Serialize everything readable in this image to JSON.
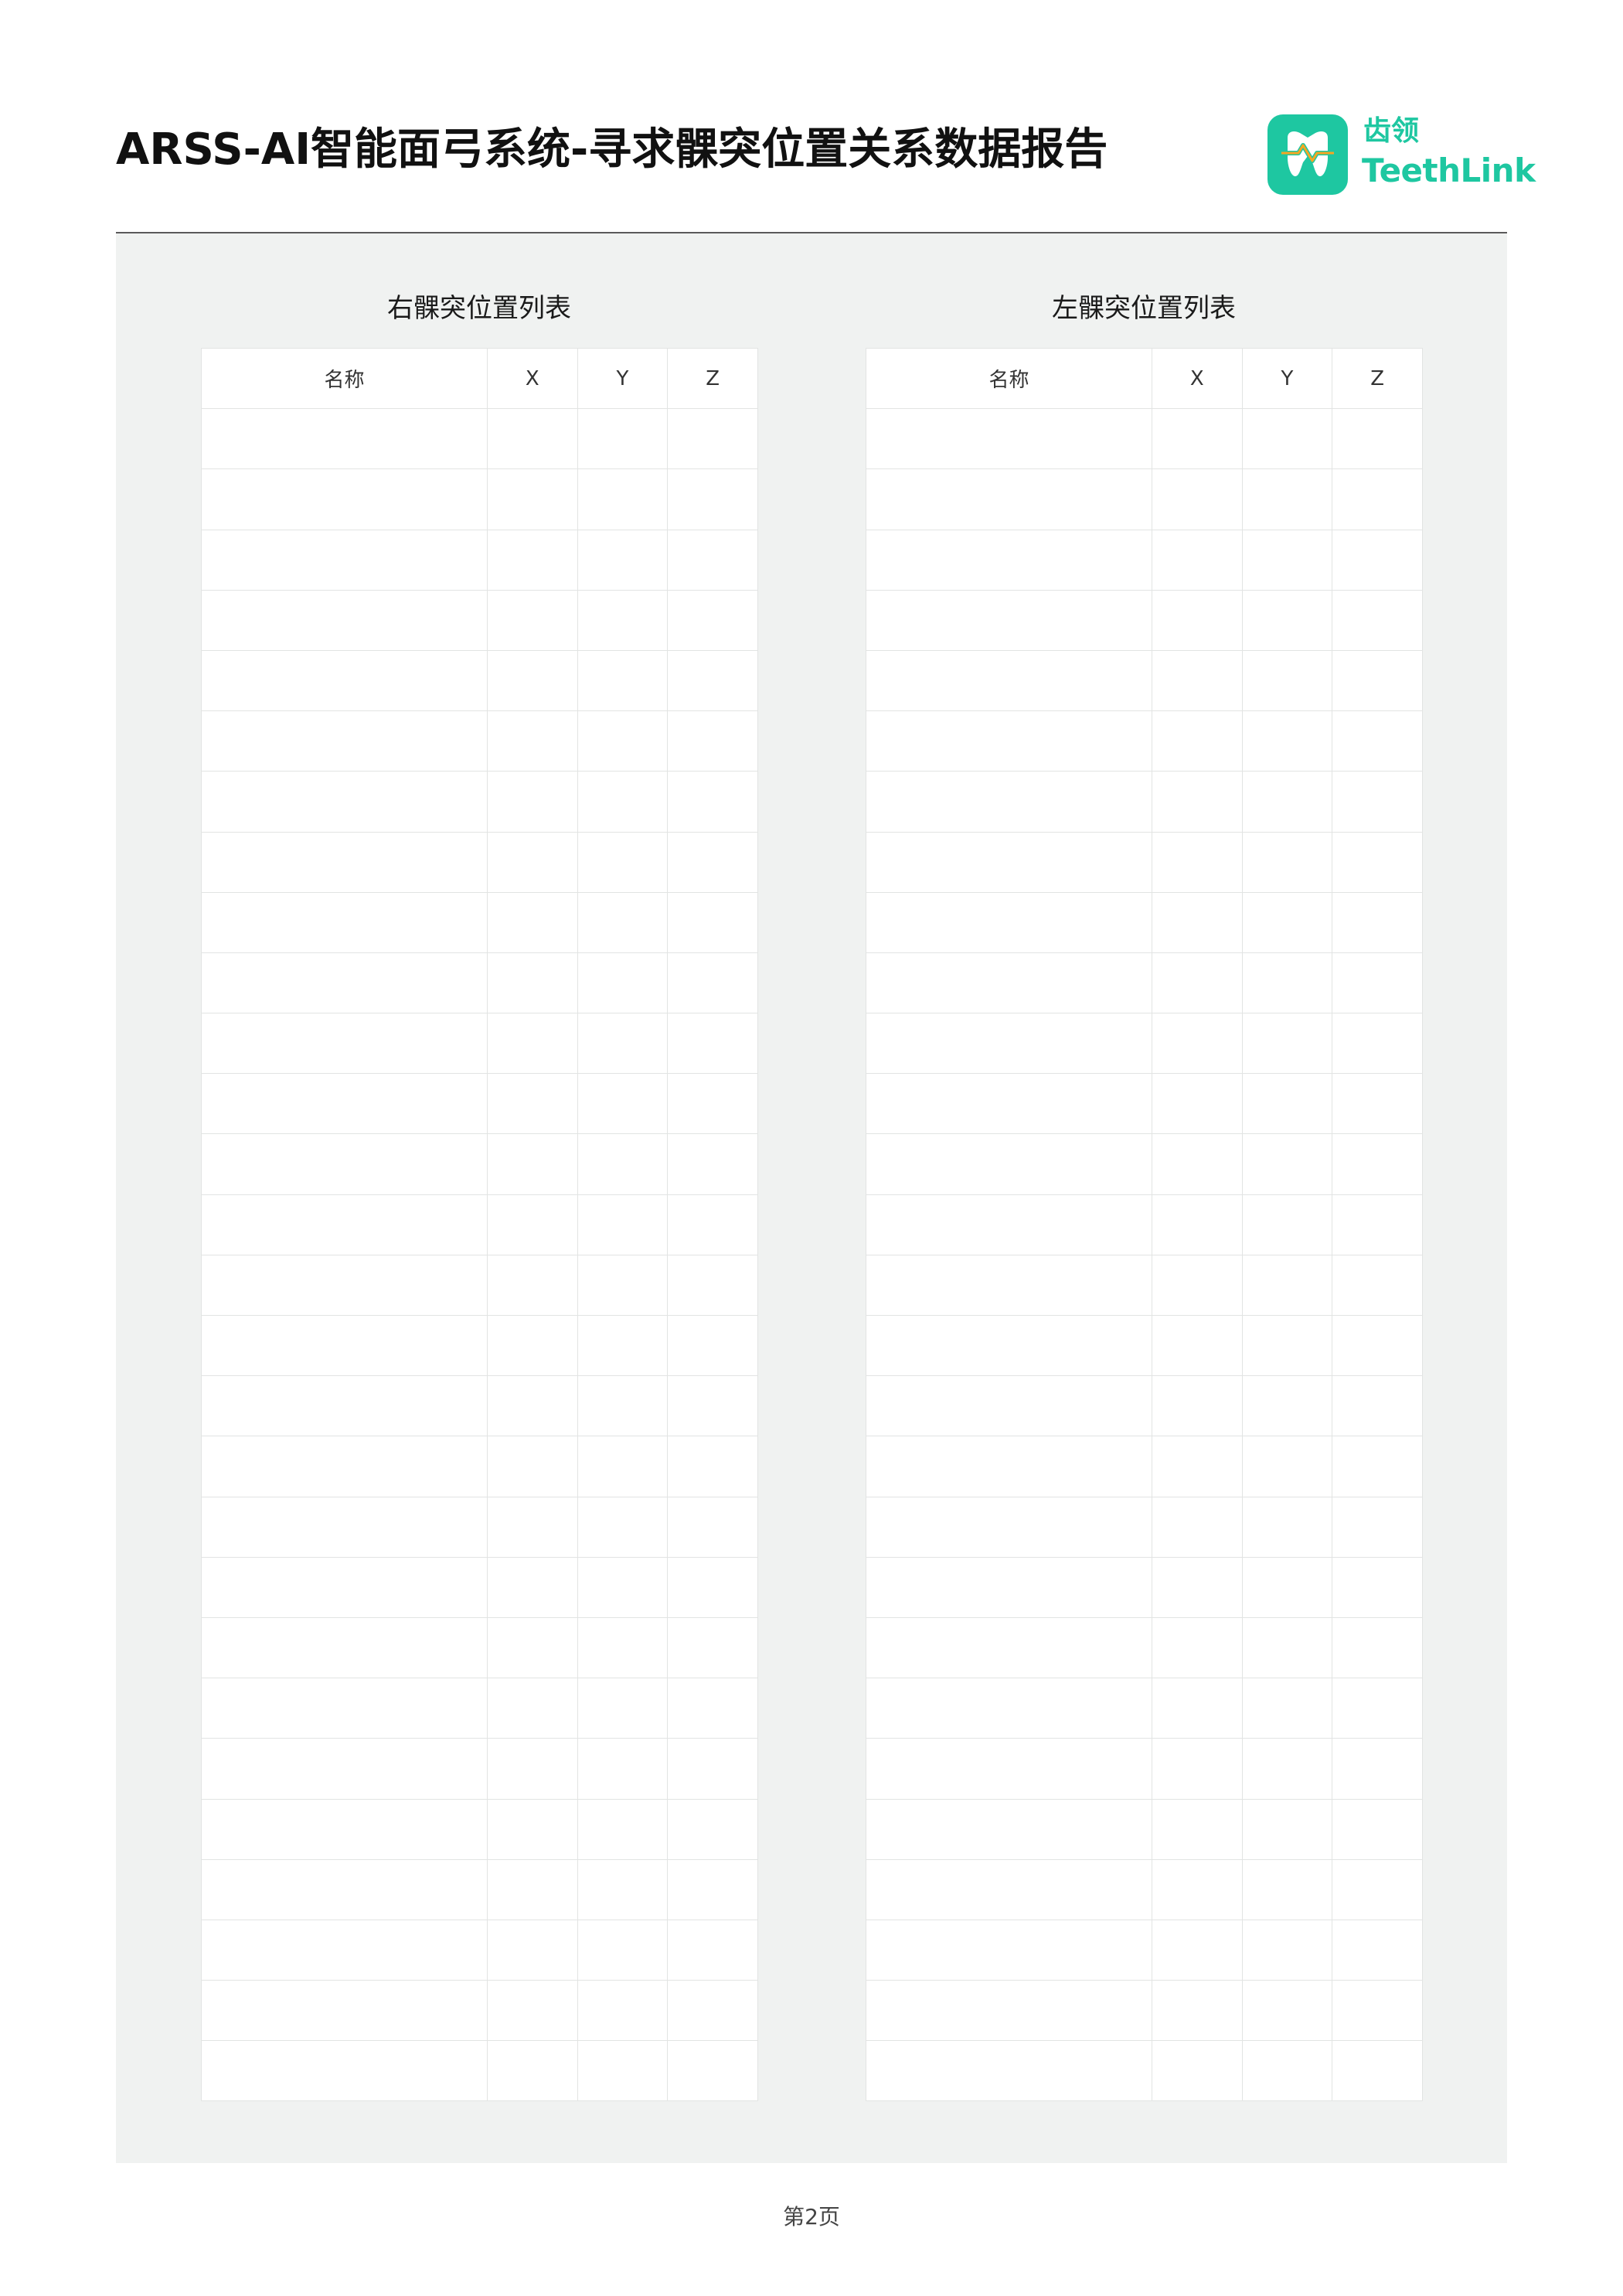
{
  "header": {
    "title": "ARSS-AI智能面弓系统-寻求髁突位置关系数据报告",
    "logo": {
      "cn_text": "齿领",
      "en_text": "TeethLink",
      "icon": "tooth-icon",
      "brand_color": "#1ec7a1",
      "accent_color": "#f5a623"
    }
  },
  "tables": [
    {
      "caption": "右髁突位置列表",
      "columns": [
        "名称",
        "X",
        "Y",
        "Z"
      ],
      "rows": [
        [
          "",
          "",
          "",
          ""
        ],
        [
          "",
          "",
          "",
          ""
        ],
        [
          "",
          "",
          "",
          ""
        ],
        [
          "",
          "",
          "",
          ""
        ],
        [
          "",
          "",
          "",
          ""
        ],
        [
          "",
          "",
          "",
          ""
        ],
        [
          "",
          "",
          "",
          ""
        ],
        [
          "",
          "",
          "",
          ""
        ],
        [
          "",
          "",
          "",
          ""
        ],
        [
          "",
          "",
          "",
          ""
        ],
        [
          "",
          "",
          "",
          ""
        ],
        [
          "",
          "",
          "",
          ""
        ],
        [
          "",
          "",
          "",
          ""
        ],
        [
          "",
          "",
          "",
          ""
        ],
        [
          "",
          "",
          "",
          ""
        ],
        [
          "",
          "",
          "",
          ""
        ],
        [
          "",
          "",
          "",
          ""
        ],
        [
          "",
          "",
          "",
          ""
        ],
        [
          "",
          "",
          "",
          ""
        ],
        [
          "",
          "",
          "",
          ""
        ],
        [
          "",
          "",
          "",
          ""
        ],
        [
          "",
          "",
          "",
          ""
        ],
        [
          "",
          "",
          "",
          ""
        ],
        [
          "",
          "",
          "",
          ""
        ],
        [
          "",
          "",
          "",
          ""
        ],
        [
          "",
          "",
          "",
          ""
        ],
        [
          "",
          "",
          "",
          ""
        ],
        [
          "",
          "",
          "",
          ""
        ]
      ]
    },
    {
      "caption": "左髁突位置列表",
      "columns": [
        "名称",
        "X",
        "Y",
        "Z"
      ],
      "rows": [
        [
          "",
          "",
          "",
          ""
        ],
        [
          "",
          "",
          "",
          ""
        ],
        [
          "",
          "",
          "",
          ""
        ],
        [
          "",
          "",
          "",
          ""
        ],
        [
          "",
          "",
          "",
          ""
        ],
        [
          "",
          "",
          "",
          ""
        ],
        [
          "",
          "",
          "",
          ""
        ],
        [
          "",
          "",
          "",
          ""
        ],
        [
          "",
          "",
          "",
          ""
        ],
        [
          "",
          "",
          "",
          ""
        ],
        [
          "",
          "",
          "",
          ""
        ],
        [
          "",
          "",
          "",
          ""
        ],
        [
          "",
          "",
          "",
          ""
        ],
        [
          "",
          "",
          "",
          ""
        ],
        [
          "",
          "",
          "",
          ""
        ],
        [
          "",
          "",
          "",
          ""
        ],
        [
          "",
          "",
          "",
          ""
        ],
        [
          "",
          "",
          "",
          ""
        ],
        [
          "",
          "",
          "",
          ""
        ],
        [
          "",
          "",
          "",
          ""
        ],
        [
          "",
          "",
          "",
          ""
        ],
        [
          "",
          "",
          "",
          ""
        ],
        [
          "",
          "",
          "",
          ""
        ],
        [
          "",
          "",
          "",
          ""
        ],
        [
          "",
          "",
          "",
          ""
        ],
        [
          "",
          "",
          "",
          ""
        ],
        [
          "",
          "",
          "",
          ""
        ],
        [
          "",
          "",
          "",
          ""
        ]
      ]
    }
  ],
  "footer": {
    "page_label": "第2页"
  }
}
